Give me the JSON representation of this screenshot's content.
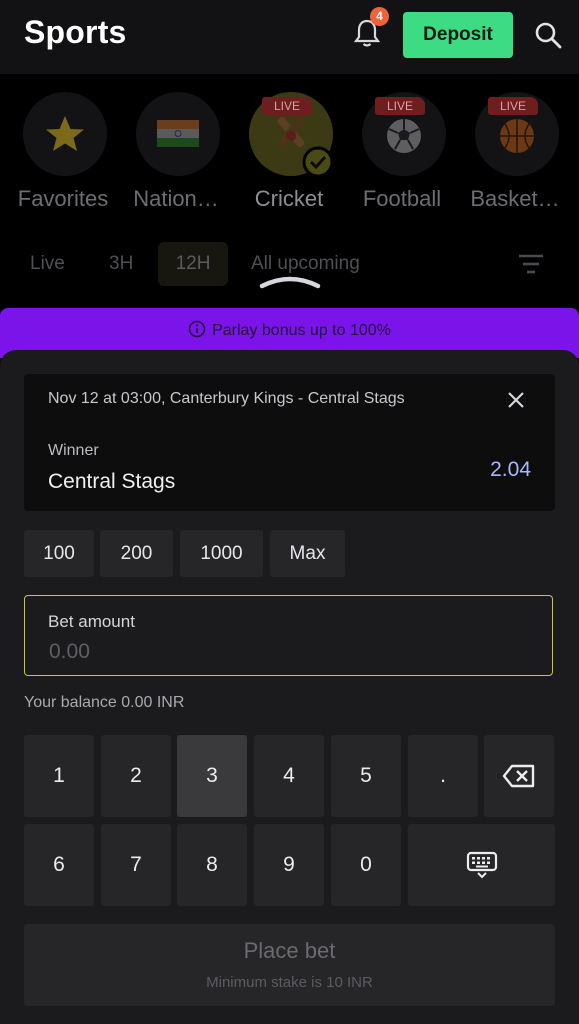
{
  "header": {
    "title": "Sports",
    "notification_count": "4",
    "deposit_label": "Deposit"
  },
  "categories": [
    {
      "label": "Favorites",
      "live": false
    },
    {
      "label": "Nation…",
      "live": false
    },
    {
      "label": "Cricket",
      "live": true,
      "live_label": "LIVE",
      "selected": true
    },
    {
      "label": "Football",
      "live": true,
      "live_label": "LIVE"
    },
    {
      "label": "Basket…",
      "live": true,
      "live_label": "LIVE"
    }
  ],
  "time_tabs": {
    "items": [
      "Live",
      "3H",
      "12H",
      "All upcoming"
    ],
    "active": "12H"
  },
  "banner": {
    "text": "Parlay bonus up to 100%"
  },
  "bet_slip": {
    "match": "Nov 12 at 03:00, Canterbury Kings - Central Stags",
    "market": "Winner",
    "selection": "Central Stags",
    "odds": "2.04",
    "quick_amounts": [
      "100",
      "200",
      "1000",
      "Max"
    ],
    "amount_label": "Bet amount",
    "amount_placeholder": "0.00",
    "balance_text": "Your balance 0.00 INR",
    "keypad_row1": [
      "1",
      "2",
      "3",
      "4",
      "5",
      "."
    ],
    "keypad_row2": [
      "6",
      "7",
      "8",
      "9",
      "0"
    ],
    "pressed_key": "3",
    "place_bet_label": "Place bet",
    "min_stake_text": "Minimum stake is 10 INR"
  },
  "colors": {
    "accent_green": "#3ddc84",
    "banner_purple": "#7a14e8",
    "odds_blue": "#a9b7ff",
    "input_border": "#c7c83b"
  }
}
